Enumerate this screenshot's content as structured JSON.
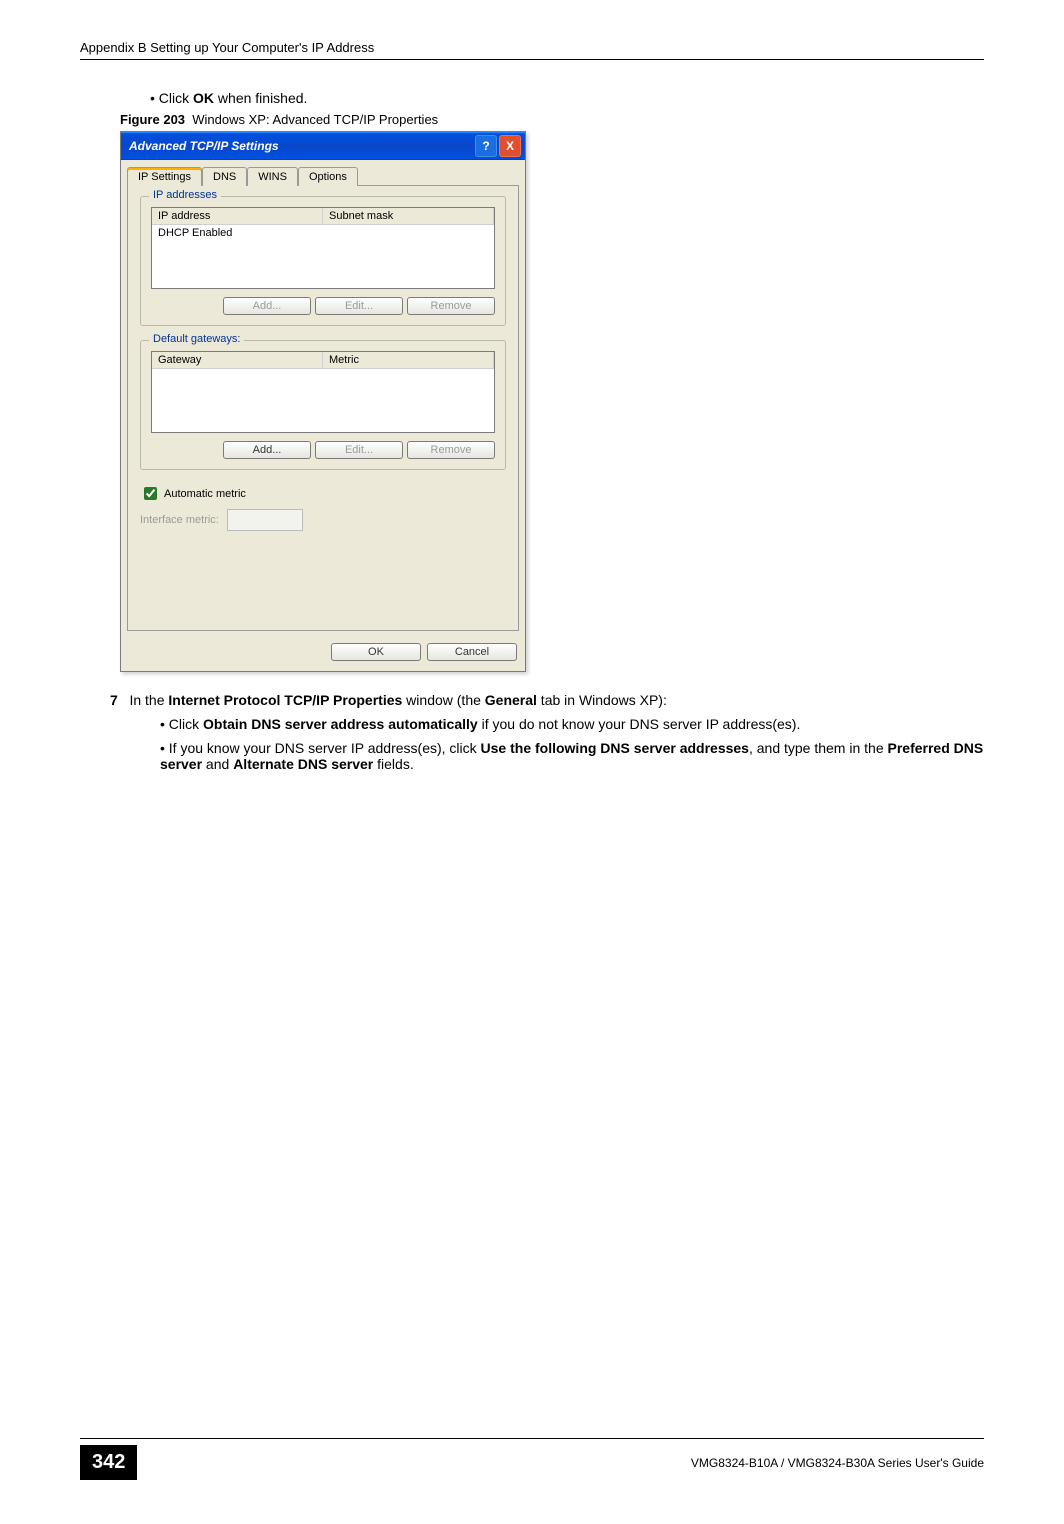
{
  "header": "Appendix B Setting up Your Computer's IP Address",
  "instructions": {
    "click_ok": "Click OK when finished.",
    "fig_caption_label": "Figure 203",
    "fig_caption_text": "Windows XP: Advanced TCP/IP Properties",
    "step7_num": "7",
    "step7_text_pre": "In the ",
    "step7_bold1": "Internet Protocol TCP/IP Properties",
    "step7_text_mid": " window (the ",
    "step7_bold2": "General",
    "step7_text_post": " tab in Windows XP):",
    "sub1_pre": "Click ",
    "sub1_bold": "Obtain DNS server address automatically",
    "sub1_post": " if you do not know your DNS server IP address(es).",
    "sub2_pre": "If you know your DNS server IP address(es), click ",
    "sub2_bold1": "Use the following DNS server addresses",
    "sub2_mid": ", and type them in the ",
    "sub2_bold2": "Preferred DNS server",
    "sub2_and": " and ",
    "sub2_bold3": "Alternate DNS server",
    "sub2_post": " fields."
  },
  "dialog": {
    "title": "Advanced TCP/IP Settings",
    "help_btn": "?",
    "close_btn": "X",
    "tabs": {
      "ip": "IP Settings",
      "dns": "DNS",
      "wins": "WINS",
      "options": "Options"
    },
    "group_ip": {
      "title": "IP addresses",
      "col1": "IP address",
      "col2": "Subnet mask",
      "row1": "DHCP Enabled"
    },
    "group_gw": {
      "title": "Default gateways:",
      "col1": "Gateway",
      "col2": "Metric"
    },
    "btns": {
      "add": "Add...",
      "edit": "Edit...",
      "remove": "Remove"
    },
    "auto_metric": "Automatic metric",
    "iface_metric": "Interface metric:",
    "ok": "OK",
    "cancel": "Cancel"
  },
  "footer": {
    "page": "342",
    "guide": "VMG8324-B10A / VMG8324-B30A Series User's Guide"
  }
}
